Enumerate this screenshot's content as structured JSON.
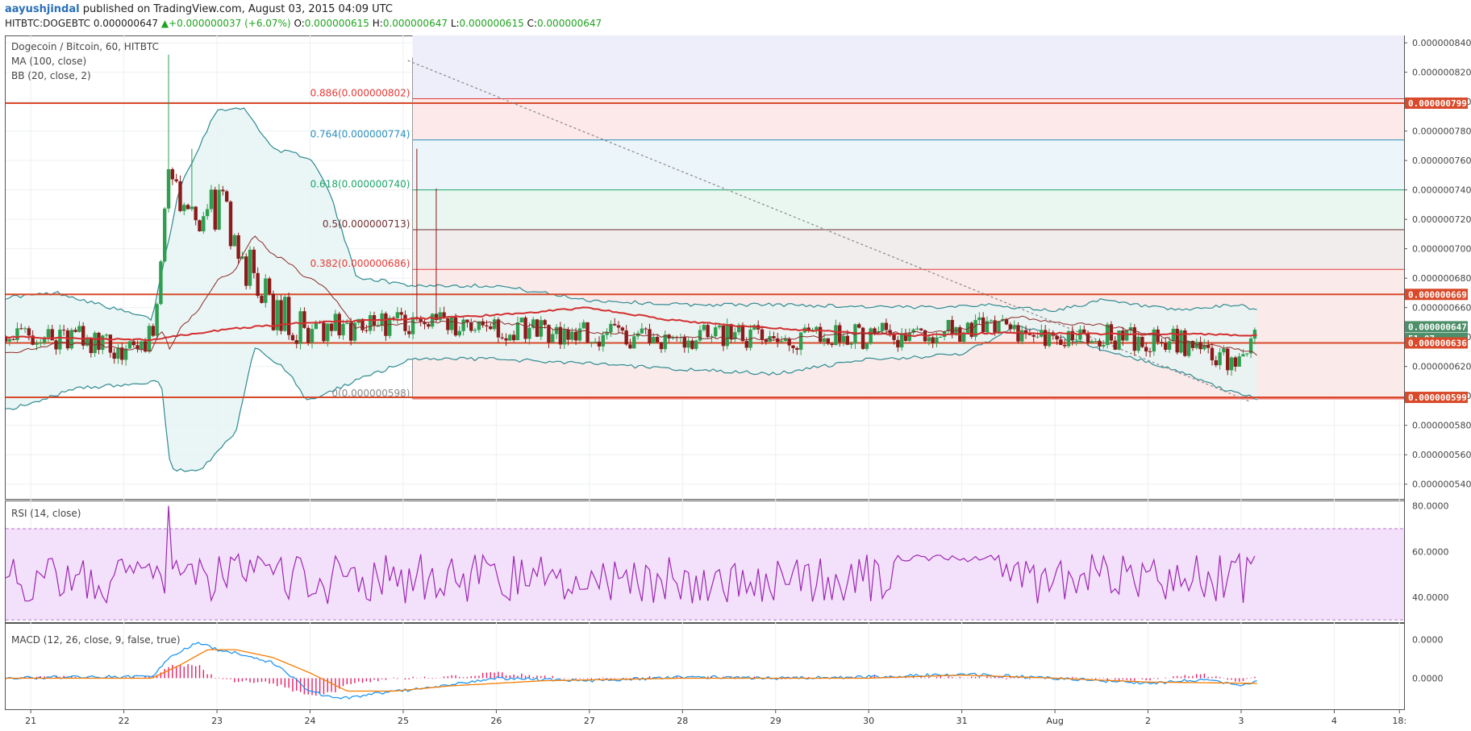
{
  "header": {
    "author": "aayushjindal",
    "published_text": " published on TradingView.com, August 03, 2015 04:09 UTC",
    "symbol": "HITBTC:DOGEBTC",
    "last": "0.000000647",
    "change": "+0.000000037 (+6.07%)",
    "o_label": "O:",
    "o": "0.000000615",
    "h_label": "H:",
    "h": "0.000000647",
    "l_label": "L:",
    "l": "0.000000615",
    "c_label": "C:",
    "c": "0.000000647"
  },
  "legends": {
    "main_title": "Dogecoin / Bitcoin, 60, HITBTC",
    "ma": "MA (100, close)",
    "bb": "BB (20, close, 2)",
    "rsi": "RSI (14, close)",
    "macd": "MACD (12, 26, close, 9, false, true)"
  },
  "colors": {
    "up": "#2e9e4f",
    "down": "#8b1a1a",
    "ma": "#d32f2f",
    "bb": "#2f8a91",
    "bb_fill": "#e6f4f3",
    "hline": "#d84a2a",
    "rsi": "#9c27b0",
    "rsi_band": "#f3e0fb",
    "macd": "#2196f3",
    "signal": "#f57c00",
    "hist": "#e91e63",
    "fib_red": "#e53935",
    "fib_blue": "#2c8fbd",
    "fib_green": "#1aa56b",
    "fib_dark": "#6d2f2f"
  },
  "chart_data": [
    {
      "type": "candlestick",
      "title": "Dogecoin / Bitcoin, 60, HITBTC",
      "ylim": [
        5.3e-07,
        8.45e-07
      ],
      "y_ticks": [
        "0.000000840",
        "0.000000820",
        "0.000000800",
        "0.000000780",
        "0.000000760",
        "0.000000740",
        "0.000000720",
        "0.000000700",
        "0.000000680",
        "0.000000660",
        "0.000000640",
        "0.000000620",
        "0.000000600",
        "0.000000580",
        "0.000000560",
        "0.000000540"
      ],
      "y_tick_values": [
        8.4e-07,
        8.2e-07,
        8e-07,
        7.8e-07,
        7.6e-07,
        7.4e-07,
        7.2e-07,
        7e-07,
        6.8e-07,
        6.6e-07,
        6.4e-07,
        6.2e-07,
        6e-07,
        5.8e-07,
        5.6e-07,
        5.4e-07
      ],
      "x_ticks": [
        "21",
        "22",
        "23",
        "24",
        "25",
        "26",
        "27",
        "28",
        "29",
        "30",
        "31",
        "Aug",
        "2",
        "3",
        "4",
        "18:"
      ],
      "x_tick_days": [
        0,
        1,
        2,
        3,
        4,
        5,
        6,
        7,
        8,
        9,
        10,
        11,
        12,
        13,
        14,
        14.7
      ],
      "xlim_days": [
        -0.27,
        14.75
      ],
      "fib_levels": [
        {
          "ratio": "0.886",
          "label": "0.886(0.000000802)",
          "value": 8.02e-07,
          "color": "fib_red"
        },
        {
          "ratio": "0.764",
          "label": "0.764(0.000000774)",
          "value": 7.74e-07,
          "color": "fib_blue"
        },
        {
          "ratio": "0.618",
          "label": "0.618(0.000000740)",
          "value": 7.4e-07,
          "color": "fib_green"
        },
        {
          "ratio": "0.5",
          "label": "0.5(0.000000713)",
          "value": 7.13e-07,
          "color": "fib_dark"
        },
        {
          "ratio": "0.382",
          "label": "0.382(0.000000686)",
          "value": 6.86e-07,
          "color": "fib_red"
        },
        {
          "ratio": "0",
          "label": "0(0.000000598)",
          "value": 5.98e-07,
          "color": "fib_red"
        }
      ],
      "fib_start_day": 4.1,
      "horizontal_lines": [
        7.99e-07,
        6.69e-07,
        6.36e-07,
        5.99e-07
      ],
      "price_tags": [
        {
          "text": "0.000000799",
          "value": 7.99e-07,
          "color": "#d84a2a"
        },
        {
          "text": "0.000000669",
          "value": 6.69e-07,
          "color": "#d84a2a"
        },
        {
          "text": "0.000000647",
          "value": 6.47e-07,
          "color": "#4d8f6a"
        },
        {
          "text": "51:07",
          "value": 6.39e-07,
          "color": "#4d8f6a"
        },
        {
          "text": "0.000000636",
          "value": 6.36e-07,
          "color": "#d84a2a"
        },
        {
          "text": "0.000000599",
          "value": 5.99e-07,
          "color": "#d84a2a"
        }
      ],
      "trendline": {
        "from": [
          4.05,
          8.28e-07
        ],
        "to": [
          13.1,
          5.96e-07
        ]
      },
      "last_price": 6.47e-07,
      "anchors_close": [
        [
          -0.27,
          6.4e-07
        ],
        [
          0.5,
          6.4e-07
        ],
        [
          1.0,
          6.3e-07
        ],
        [
          1.3,
          6.4e-07
        ],
        [
          1.5,
          7.5e-07
        ],
        [
          1.8,
          7.2e-07
        ],
        [
          2.05,
          7.3e-07
        ],
        [
          2.3,
          6.9e-07
        ],
        [
          2.6,
          6.55e-07
        ],
        [
          3.0,
          6.5e-07
        ],
        [
          3.5,
          6.45e-07
        ],
        [
          4.1,
          6.5e-07
        ],
        [
          4.5,
          6.48e-07
        ],
        [
          5.3,
          6.45e-07
        ],
        [
          6.3,
          6.4e-07
        ],
        [
          7.5,
          6.4e-07
        ],
        [
          8.5,
          6.4e-07
        ],
        [
          9.5,
          6.42e-07
        ],
        [
          10.2,
          6.45e-07
        ],
        [
          11.0,
          6.4e-07
        ],
        [
          11.5,
          6.4e-07
        ],
        [
          12.3,
          6.38e-07
        ],
        [
          12.7,
          6.25e-07
        ],
        [
          13.0,
          6.22e-07
        ],
        [
          13.17,
          6.47e-07
        ]
      ],
      "spikes": [
        [
          1.47,
          8.32e-07
        ],
        [
          4.15,
          7.68e-07
        ],
        [
          4.37,
          7.41e-07
        ],
        [
          1.72,
          7.68e-07
        ]
      ],
      "ma_anchors": [
        [
          -0.27,
          6.4e-07
        ],
        [
          1.3,
          6.38e-07
        ],
        [
          1.6,
          6.41e-07
        ],
        [
          2.2,
          6.46e-07
        ],
        [
          3.0,
          6.5e-07
        ],
        [
          4.0,
          6.52e-07
        ],
        [
          5.0,
          6.55e-07
        ],
        [
          6.0,
          6.6e-07
        ],
        [
          6.8,
          6.52e-07
        ],
        [
          7.5,
          6.48e-07
        ],
        [
          8.5,
          6.44e-07
        ],
        [
          9.5,
          6.41e-07
        ],
        [
          10.5,
          6.43e-07
        ],
        [
          11.5,
          6.42e-07
        ],
        [
          12.5,
          6.42e-07
        ],
        [
          13.17,
          6.41e-07
        ]
      ],
      "bb_upper": [
        [
          -0.27,
          6.67e-07
        ],
        [
          0.3,
          6.7e-07
        ],
        [
          1.3,
          6.52e-07
        ],
        [
          1.6,
          7.42e-07
        ],
        [
          2.0,
          7.95e-07
        ],
        [
          2.3,
          7.95e-07
        ],
        [
          2.6,
          7.68e-07
        ],
        [
          3.0,
          7.62e-07
        ],
        [
          3.2,
          7.4e-07
        ],
        [
          3.5,
          6.81e-07
        ],
        [
          4.1,
          6.75e-07
        ],
        [
          5.0,
          6.75e-07
        ],
        [
          6.0,
          6.65e-07
        ],
        [
          7.0,
          6.62e-07
        ],
        [
          8.0,
          6.62e-07
        ],
        [
          9.5,
          6.6e-07
        ],
        [
          10.2,
          6.62e-07
        ],
        [
          11.0,
          6.58e-07
        ],
        [
          11.5,
          6.65e-07
        ],
        [
          12.3,
          6.58e-07
        ],
        [
          13.0,
          6.62e-07
        ],
        [
          13.17,
          6.58e-07
        ]
      ],
      "bb_lower": [
        [
          -0.27,
          5.9e-07
        ],
        [
          0.5,
          6.05e-07
        ],
        [
          1.4,
          6.1e-07
        ],
        [
          1.5,
          5.5e-07
        ],
        [
          1.8,
          5.48e-07
        ],
        [
          2.2,
          5.75e-07
        ],
        [
          2.4,
          6.33e-07
        ],
        [
          2.8,
          6.15e-07
        ],
        [
          2.95,
          5.96e-07
        ],
        [
          3.4,
          6.08e-07
        ],
        [
          4.1,
          6.25e-07
        ],
        [
          5.0,
          6.25e-07
        ],
        [
          6.0,
          6.22e-07
        ],
        [
          7.0,
          6.18e-07
        ],
        [
          8.0,
          6.15e-07
        ],
        [
          9.0,
          6.25e-07
        ],
        [
          10.0,
          6.28e-07
        ],
        [
          10.6,
          6.48e-07
        ],
        [
          11.5,
          6.32e-07
        ],
        [
          12.3,
          6.18e-07
        ],
        [
          12.8,
          6.05e-07
        ],
        [
          13.17,
          5.98e-07
        ]
      ]
    },
    {
      "type": "line",
      "title": "RSI (14, close)",
      "ylim": [
        29,
        82
      ],
      "y_ticks": [
        "80.0000",
        "60.0000",
        "40.0000"
      ],
      "y_tick_values": [
        80,
        60,
        40
      ],
      "band": [
        30,
        70
      ],
      "spike_day": 1.47,
      "spike_value": 80,
      "end_value": 58
    },
    {
      "type": "line",
      "title": "MACD (12, 26, close, 9, false, true)",
      "ylim": [
        -1.2e-08,
        2.1e-08
      ],
      "y_ticks": [
        "0.0000",
        "0.0000"
      ],
      "y_tick_values": [
        1.5e-08,
        0
      ],
      "macd_anchors": [
        [
          -0.27,
          0.0
        ],
        [
          0.5,
          5e-10
        ],
        [
          1.3,
          5e-10
        ],
        [
          1.5,
          8e-09
        ],
        [
          1.8,
          1.4e-08
        ],
        [
          2.0,
          1.1e-08
        ],
        [
          2.3,
          9e-09
        ],
        [
          2.6,
          6e-09
        ],
        [
          3.0,
          -5e-09
        ],
        [
          3.3,
          -8e-09
        ],
        [
          3.7,
          -6e-09
        ],
        [
          4.2,
          -4e-09
        ],
        [
          5.0,
          0.0
        ],
        [
          6.0,
          -1e-09
        ],
        [
          7.0,
          5e-10
        ],
        [
          8.0,
          0.0
        ],
        [
          9.0,
          5e-10
        ],
        [
          10.0,
          1.5e-09
        ],
        [
          11.0,
          0.0
        ],
        [
          12.0,
          -2e-09
        ],
        [
          12.6,
          -5e-10
        ],
        [
          13.0,
          -3e-09
        ],
        [
          13.17,
          -1.5e-09
        ]
      ],
      "signal_anchors": [
        [
          -0.27,
          0.0
        ],
        [
          1.3,
          0.0
        ],
        [
          1.6,
          5e-09
        ],
        [
          1.9,
          1.1e-08
        ],
        [
          2.2,
          1.1e-08
        ],
        [
          2.6,
          8e-09
        ],
        [
          3.0,
          2e-09
        ],
        [
          3.4,
          -5e-09
        ],
        [
          3.9,
          -5e-09
        ],
        [
          4.5,
          -3e-09
        ],
        [
          5.5,
          -1e-09
        ],
        [
          7.0,
          0.0
        ],
        [
          9.0,
          0.0
        ],
        [
          10.0,
          1.2e-09
        ],
        [
          11.0,
          0.0
        ],
        [
          12.0,
          -1.5e-09
        ],
        [
          13.17,
          -2e-09
        ]
      ]
    }
  ]
}
